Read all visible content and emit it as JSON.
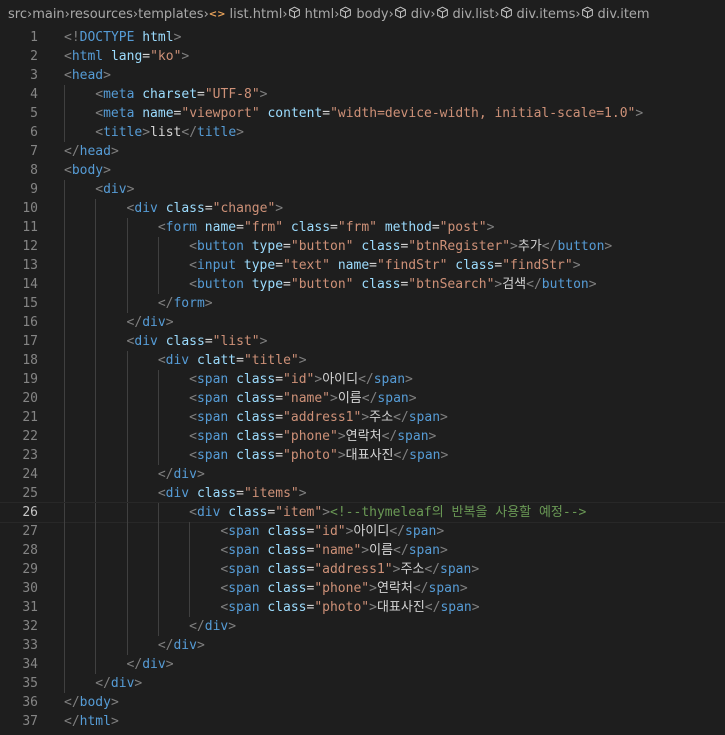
{
  "breadcrumbs": [
    {
      "label": "src",
      "icon": ""
    },
    {
      "label": "main",
      "icon": ""
    },
    {
      "label": "resources",
      "icon": ""
    },
    {
      "label": "templates",
      "icon": ""
    },
    {
      "label": "list.html",
      "icon": "html-file-icon"
    },
    {
      "label": "html",
      "icon": "element-icon"
    },
    {
      "label": "body",
      "icon": "element-icon"
    },
    {
      "label": "div",
      "icon": "element-icon"
    },
    {
      "label": "div.list",
      "icon": "element-icon"
    },
    {
      "label": "div.items",
      "icon": "element-icon"
    },
    {
      "label": "div.item",
      "icon": "element-icon"
    }
  ],
  "active_line": 26,
  "colors": {
    "tag": "#569cd6",
    "attr": "#9cdcfe",
    "string": "#ce9178",
    "text": "#d4d4d4",
    "comment": "#6a9955",
    "punct": "#808080"
  },
  "lines": [
    {
      "n": "1",
      "indent": 0,
      "tokens": [
        [
          "pun",
          "<!"
        ],
        [
          "kw",
          "DOCTYPE"
        ],
        [
          "txt",
          " "
        ],
        [
          "attr",
          "html"
        ],
        [
          "pun",
          ">"
        ]
      ]
    },
    {
      "n": "2",
      "indent": 0,
      "tokens": [
        [
          "pun",
          "<"
        ],
        [
          "tag",
          "html"
        ],
        [
          "txt",
          " "
        ],
        [
          "attr",
          "lang"
        ],
        [
          "txt",
          "="
        ],
        [
          "str",
          "\"ko\""
        ],
        [
          "pun",
          ">"
        ]
      ]
    },
    {
      "n": "3",
      "indent": 0,
      "tokens": [
        [
          "pun",
          "<"
        ],
        [
          "tag",
          "head"
        ],
        [
          "pun",
          ">"
        ]
      ]
    },
    {
      "n": "4",
      "indent": 1,
      "tokens": [
        [
          "pun",
          "<"
        ],
        [
          "tag",
          "meta"
        ],
        [
          "txt",
          " "
        ],
        [
          "attr",
          "charset"
        ],
        [
          "txt",
          "="
        ],
        [
          "str",
          "\"UTF-8\""
        ],
        [
          "pun",
          ">"
        ]
      ]
    },
    {
      "n": "5",
      "indent": 1,
      "tokens": [
        [
          "pun",
          "<"
        ],
        [
          "tag",
          "meta"
        ],
        [
          "txt",
          " "
        ],
        [
          "attr",
          "name"
        ],
        [
          "txt",
          "="
        ],
        [
          "str",
          "\"viewport\""
        ],
        [
          "txt",
          " "
        ],
        [
          "attr",
          "content"
        ],
        [
          "txt",
          "="
        ],
        [
          "str",
          "\"width=device-width, initial-scale=1.0\""
        ],
        [
          "pun",
          ">"
        ]
      ]
    },
    {
      "n": "6",
      "indent": 1,
      "tokens": [
        [
          "pun",
          "<"
        ],
        [
          "tag",
          "title"
        ],
        [
          "pun",
          ">"
        ],
        [
          "txt",
          "list"
        ],
        [
          "pun",
          "</"
        ],
        [
          "tag",
          "title"
        ],
        [
          "pun",
          ">"
        ]
      ]
    },
    {
      "n": "7",
      "indent": 0,
      "tokens": [
        [
          "pun",
          "</"
        ],
        [
          "tag",
          "head"
        ],
        [
          "pun",
          ">"
        ]
      ]
    },
    {
      "n": "8",
      "indent": 0,
      "tokens": [
        [
          "pun",
          "<"
        ],
        [
          "tag",
          "body"
        ],
        [
          "pun",
          ">"
        ]
      ]
    },
    {
      "n": "9",
      "indent": 1,
      "tokens": [
        [
          "pun",
          "<"
        ],
        [
          "tag",
          "div"
        ],
        [
          "pun",
          ">"
        ]
      ]
    },
    {
      "n": "10",
      "indent": 2,
      "tokens": [
        [
          "pun",
          "<"
        ],
        [
          "tag",
          "div"
        ],
        [
          "txt",
          " "
        ],
        [
          "attr",
          "class"
        ],
        [
          "txt",
          "="
        ],
        [
          "str",
          "\"change\""
        ],
        [
          "pun",
          ">"
        ]
      ]
    },
    {
      "n": "11",
      "indent": 3,
      "tokens": [
        [
          "pun",
          "<"
        ],
        [
          "tag",
          "form"
        ],
        [
          "txt",
          " "
        ],
        [
          "attr",
          "name"
        ],
        [
          "txt",
          "="
        ],
        [
          "str",
          "\"frm\""
        ],
        [
          "txt",
          " "
        ],
        [
          "attr",
          "class"
        ],
        [
          "txt",
          "="
        ],
        [
          "str",
          "\"frm\""
        ],
        [
          "txt",
          " "
        ],
        [
          "attr",
          "method"
        ],
        [
          "txt",
          "="
        ],
        [
          "str",
          "\"post\""
        ],
        [
          "pun",
          ">"
        ]
      ]
    },
    {
      "n": "12",
      "indent": 4,
      "tokens": [
        [
          "pun",
          "<"
        ],
        [
          "tag",
          "button"
        ],
        [
          "txt",
          " "
        ],
        [
          "attr",
          "type"
        ],
        [
          "txt",
          "="
        ],
        [
          "str",
          "\"button\""
        ],
        [
          "txt",
          " "
        ],
        [
          "attr",
          "class"
        ],
        [
          "txt",
          "="
        ],
        [
          "str",
          "\"btnRegister\""
        ],
        [
          "pun",
          ">"
        ],
        [
          "txt",
          "추가"
        ],
        [
          "pun",
          "</"
        ],
        [
          "tag",
          "button"
        ],
        [
          "pun",
          ">"
        ]
      ]
    },
    {
      "n": "13",
      "indent": 4,
      "tokens": [
        [
          "pun",
          "<"
        ],
        [
          "tag",
          "input"
        ],
        [
          "txt",
          " "
        ],
        [
          "attr",
          "type"
        ],
        [
          "txt",
          "="
        ],
        [
          "str",
          "\"text\""
        ],
        [
          "txt",
          " "
        ],
        [
          "attr",
          "name"
        ],
        [
          "txt",
          "="
        ],
        [
          "str",
          "\"findStr\""
        ],
        [
          "txt",
          " "
        ],
        [
          "attr",
          "class"
        ],
        [
          "txt",
          "="
        ],
        [
          "str",
          "\"findStr\""
        ],
        [
          "pun",
          ">"
        ]
      ]
    },
    {
      "n": "14",
      "indent": 4,
      "tokens": [
        [
          "pun",
          "<"
        ],
        [
          "tag",
          "button"
        ],
        [
          "txt",
          " "
        ],
        [
          "attr",
          "type"
        ],
        [
          "txt",
          "="
        ],
        [
          "str",
          "\"button\""
        ],
        [
          "txt",
          " "
        ],
        [
          "attr",
          "class"
        ],
        [
          "txt",
          "="
        ],
        [
          "str",
          "\"btnSearch\""
        ],
        [
          "pun",
          ">"
        ],
        [
          "txt",
          "검색"
        ],
        [
          "pun",
          "</"
        ],
        [
          "tag",
          "button"
        ],
        [
          "pun",
          ">"
        ]
      ]
    },
    {
      "n": "15",
      "indent": 3,
      "tokens": [
        [
          "pun",
          "</"
        ],
        [
          "tag",
          "form"
        ],
        [
          "pun",
          ">"
        ]
      ]
    },
    {
      "n": "16",
      "indent": 2,
      "tokens": [
        [
          "pun",
          "</"
        ],
        [
          "tag",
          "div"
        ],
        [
          "pun",
          ">"
        ]
      ]
    },
    {
      "n": "17",
      "indent": 2,
      "tokens": [
        [
          "pun",
          "<"
        ],
        [
          "tag",
          "div"
        ],
        [
          "txt",
          " "
        ],
        [
          "attr",
          "class"
        ],
        [
          "txt",
          "="
        ],
        [
          "str",
          "\"list\""
        ],
        [
          "pun",
          ">"
        ]
      ]
    },
    {
      "n": "18",
      "indent": 3,
      "tokens": [
        [
          "pun",
          "<"
        ],
        [
          "tag",
          "div"
        ],
        [
          "txt",
          " "
        ],
        [
          "attr",
          "clatt"
        ],
        [
          "txt",
          "="
        ],
        [
          "str",
          "\"title\""
        ],
        [
          "pun",
          ">"
        ]
      ]
    },
    {
      "n": "19",
      "indent": 4,
      "tokens": [
        [
          "pun",
          "<"
        ],
        [
          "tag",
          "span"
        ],
        [
          "txt",
          " "
        ],
        [
          "attr",
          "class"
        ],
        [
          "txt",
          "="
        ],
        [
          "str",
          "\"id\""
        ],
        [
          "pun",
          ">"
        ],
        [
          "txt",
          "아이디"
        ],
        [
          "pun",
          "</"
        ],
        [
          "tag",
          "span"
        ],
        [
          "pun",
          ">"
        ]
      ]
    },
    {
      "n": "20",
      "indent": 4,
      "tokens": [
        [
          "pun",
          "<"
        ],
        [
          "tag",
          "span"
        ],
        [
          "txt",
          " "
        ],
        [
          "attr",
          "class"
        ],
        [
          "txt",
          "="
        ],
        [
          "str",
          "\"name\""
        ],
        [
          "pun",
          ">"
        ],
        [
          "txt",
          "이름"
        ],
        [
          "pun",
          "</"
        ],
        [
          "tag",
          "span"
        ],
        [
          "pun",
          ">"
        ]
      ]
    },
    {
      "n": "21",
      "indent": 4,
      "tokens": [
        [
          "pun",
          "<"
        ],
        [
          "tag",
          "span"
        ],
        [
          "txt",
          " "
        ],
        [
          "attr",
          "class"
        ],
        [
          "txt",
          "="
        ],
        [
          "str",
          "\"address1\""
        ],
        [
          "pun",
          ">"
        ],
        [
          "txt",
          "주소"
        ],
        [
          "pun",
          "</"
        ],
        [
          "tag",
          "span"
        ],
        [
          "pun",
          ">"
        ]
      ]
    },
    {
      "n": "22",
      "indent": 4,
      "tokens": [
        [
          "pun",
          "<"
        ],
        [
          "tag",
          "span"
        ],
        [
          "txt",
          " "
        ],
        [
          "attr",
          "class"
        ],
        [
          "txt",
          "="
        ],
        [
          "str",
          "\"phone\""
        ],
        [
          "pun",
          ">"
        ],
        [
          "txt",
          "연락처"
        ],
        [
          "pun",
          "</"
        ],
        [
          "tag",
          "span"
        ],
        [
          "pun",
          ">"
        ]
      ]
    },
    {
      "n": "23",
      "indent": 4,
      "tokens": [
        [
          "pun",
          "<"
        ],
        [
          "tag",
          "span"
        ],
        [
          "txt",
          " "
        ],
        [
          "attr",
          "class"
        ],
        [
          "txt",
          "="
        ],
        [
          "str",
          "\"photo\""
        ],
        [
          "pun",
          ">"
        ],
        [
          "txt",
          "대표사진"
        ],
        [
          "pun",
          "</"
        ],
        [
          "tag",
          "span"
        ],
        [
          "pun",
          ">"
        ]
      ]
    },
    {
      "n": "24",
      "indent": 3,
      "tokens": [
        [
          "pun",
          "</"
        ],
        [
          "tag",
          "div"
        ],
        [
          "pun",
          ">"
        ]
      ]
    },
    {
      "n": "25",
      "indent": 3,
      "tokens": [
        [
          "pun",
          "<"
        ],
        [
          "tag",
          "div"
        ],
        [
          "txt",
          " "
        ],
        [
          "attr",
          "class"
        ],
        [
          "txt",
          "="
        ],
        [
          "str",
          "\"items\""
        ],
        [
          "pun",
          ">"
        ]
      ]
    },
    {
      "n": "26",
      "indent": 4,
      "tokens": [
        [
          "pun",
          "<"
        ],
        [
          "tag",
          "div"
        ],
        [
          "txt",
          " "
        ],
        [
          "attr",
          "class"
        ],
        [
          "txt",
          "="
        ],
        [
          "str",
          "\"item\""
        ],
        [
          "pun",
          ">"
        ],
        [
          "cmt",
          "<!--thymeleaf의 반복을 사용할 예정-->"
        ]
      ]
    },
    {
      "n": "27",
      "indent": 5,
      "tokens": [
        [
          "pun",
          "<"
        ],
        [
          "tag",
          "span"
        ],
        [
          "txt",
          " "
        ],
        [
          "attr",
          "class"
        ],
        [
          "txt",
          "="
        ],
        [
          "str",
          "\"id\""
        ],
        [
          "pun",
          ">"
        ],
        [
          "txt",
          "아이디"
        ],
        [
          "pun",
          "</"
        ],
        [
          "tag",
          "span"
        ],
        [
          "pun",
          ">"
        ]
      ]
    },
    {
      "n": "28",
      "indent": 5,
      "tokens": [
        [
          "pun",
          "<"
        ],
        [
          "tag",
          "span"
        ],
        [
          "txt",
          " "
        ],
        [
          "attr",
          "class"
        ],
        [
          "txt",
          "="
        ],
        [
          "str",
          "\"name\""
        ],
        [
          "pun",
          ">"
        ],
        [
          "txt",
          "이름"
        ],
        [
          "pun",
          "</"
        ],
        [
          "tag",
          "span"
        ],
        [
          "pun",
          ">"
        ]
      ]
    },
    {
      "n": "29",
      "indent": 5,
      "tokens": [
        [
          "pun",
          "<"
        ],
        [
          "tag",
          "span"
        ],
        [
          "txt",
          " "
        ],
        [
          "attr",
          "class"
        ],
        [
          "txt",
          "="
        ],
        [
          "str",
          "\"address1\""
        ],
        [
          "pun",
          ">"
        ],
        [
          "txt",
          "주소"
        ],
        [
          "pun",
          "</"
        ],
        [
          "tag",
          "span"
        ],
        [
          "pun",
          ">"
        ]
      ]
    },
    {
      "n": "30",
      "indent": 5,
      "tokens": [
        [
          "pun",
          "<"
        ],
        [
          "tag",
          "span"
        ],
        [
          "txt",
          " "
        ],
        [
          "attr",
          "class"
        ],
        [
          "txt",
          "="
        ],
        [
          "str",
          "\"phone\""
        ],
        [
          "pun",
          ">"
        ],
        [
          "txt",
          "연락처"
        ],
        [
          "pun",
          "</"
        ],
        [
          "tag",
          "span"
        ],
        [
          "pun",
          ">"
        ]
      ]
    },
    {
      "n": "31",
      "indent": 5,
      "tokens": [
        [
          "pun",
          "<"
        ],
        [
          "tag",
          "span"
        ],
        [
          "txt",
          " "
        ],
        [
          "attr",
          "class"
        ],
        [
          "txt",
          "="
        ],
        [
          "str",
          "\"photo\""
        ],
        [
          "pun",
          ">"
        ],
        [
          "txt",
          "대표사진"
        ],
        [
          "pun",
          "</"
        ],
        [
          "tag",
          "span"
        ],
        [
          "pun",
          ">"
        ]
      ]
    },
    {
      "n": "32",
      "indent": 4,
      "tokens": [
        [
          "pun",
          "</"
        ],
        [
          "tag",
          "div"
        ],
        [
          "pun",
          ">"
        ]
      ]
    },
    {
      "n": "33",
      "indent": 3,
      "tokens": [
        [
          "pun",
          "</"
        ],
        [
          "tag",
          "div"
        ],
        [
          "pun",
          ">"
        ]
      ]
    },
    {
      "n": "34",
      "indent": 2,
      "tokens": [
        [
          "pun",
          "</"
        ],
        [
          "tag",
          "div"
        ],
        [
          "pun",
          ">"
        ]
      ]
    },
    {
      "n": "35",
      "indent": 1,
      "tokens": [
        [
          "pun",
          "</"
        ],
        [
          "tag",
          "div"
        ],
        [
          "pun",
          ">"
        ]
      ]
    },
    {
      "n": "36",
      "indent": 0,
      "tokens": [
        [
          "pun",
          "</"
        ],
        [
          "tag",
          "body"
        ],
        [
          "pun",
          ">"
        ]
      ]
    },
    {
      "n": "37",
      "indent": 0,
      "tokens": [
        [
          "pun",
          "</"
        ],
        [
          "tag",
          "html"
        ],
        [
          "pun",
          ">"
        ]
      ]
    }
  ]
}
